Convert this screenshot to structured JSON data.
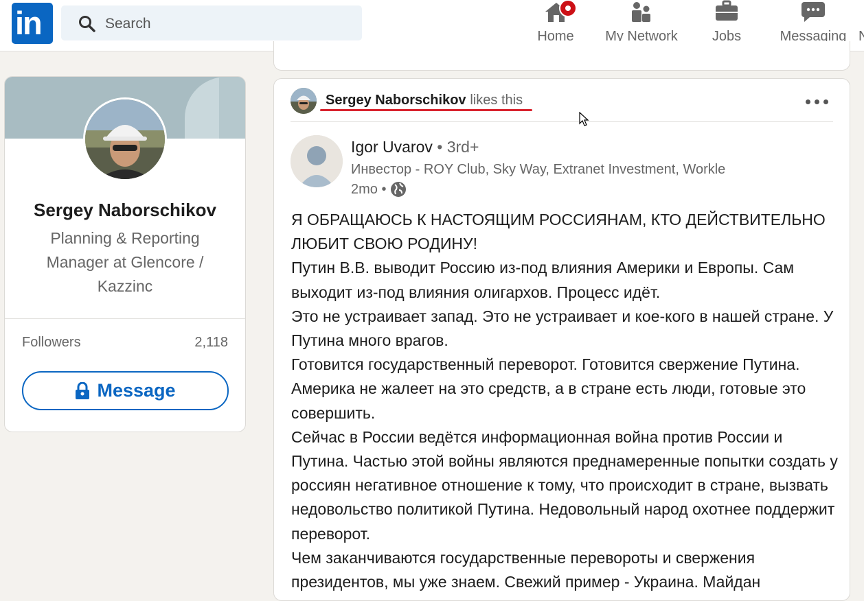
{
  "nav": {
    "logo_text": "in",
    "search_placeholder": "Search",
    "items": [
      {
        "label": "Home",
        "icon": "home-icon"
      },
      {
        "label": "My Network",
        "icon": "network-icon"
      },
      {
        "label": "Jobs",
        "icon": "briefcase-icon"
      },
      {
        "label": "Messaging",
        "icon": "messaging-icon"
      },
      {
        "label": "N"
      }
    ]
  },
  "profile": {
    "name": "Sergey Naborschikov",
    "headline": "Planning & Reporting Manager at Glencore / Kazzinc",
    "followers_label": "Followers",
    "followers_count": "2,118",
    "message_button": "Message"
  },
  "post": {
    "context_name": "Sergey Naborschikov",
    "context_action": "likes this",
    "author_name": "Igor Uvarov",
    "author_degree": "• 3rd+",
    "author_headline": "Инвестор - ROY Club, Sky Way, Extranet Investment, Workle",
    "time": "2mo •",
    "paragraphs": [
      "Я ОБРАЩАЮСЬ К НАСТОЯЩИМ РОССИЯНАМ, КТО ДЕЙСТВИТЕЛЬНО ЛЮБИТ СВОЮ РОДИНУ!",
      "Путин В.В. выводит Россию из-под влияния Америки и Европы. Сам выходит из-под влияния олигархов. Процесс идёт.",
      "Это не устраивает запад. Это не устраивает и кое-кого в нашей стране. У Путина много врагов.",
      "Готовится государственный переворот. Готовится свержение Путина. Америка не жалеет на это средств, а в стране есть люди, готовые это совершить.",
      "Сейчас в России ведётся информационная война против России и Путина. Частью этой войны являются преднамеренные попытки создать у россиян негативное отношение к тому, что происходит в стране, вызвать недовольство политикой Путина. Недовольный народ охотнее поддержит переворот.",
      "Чем заканчиваются государственные перевороты и свержения президентов, мы уже знаем. Свежий пример - Украина. Майдан"
    ]
  }
}
